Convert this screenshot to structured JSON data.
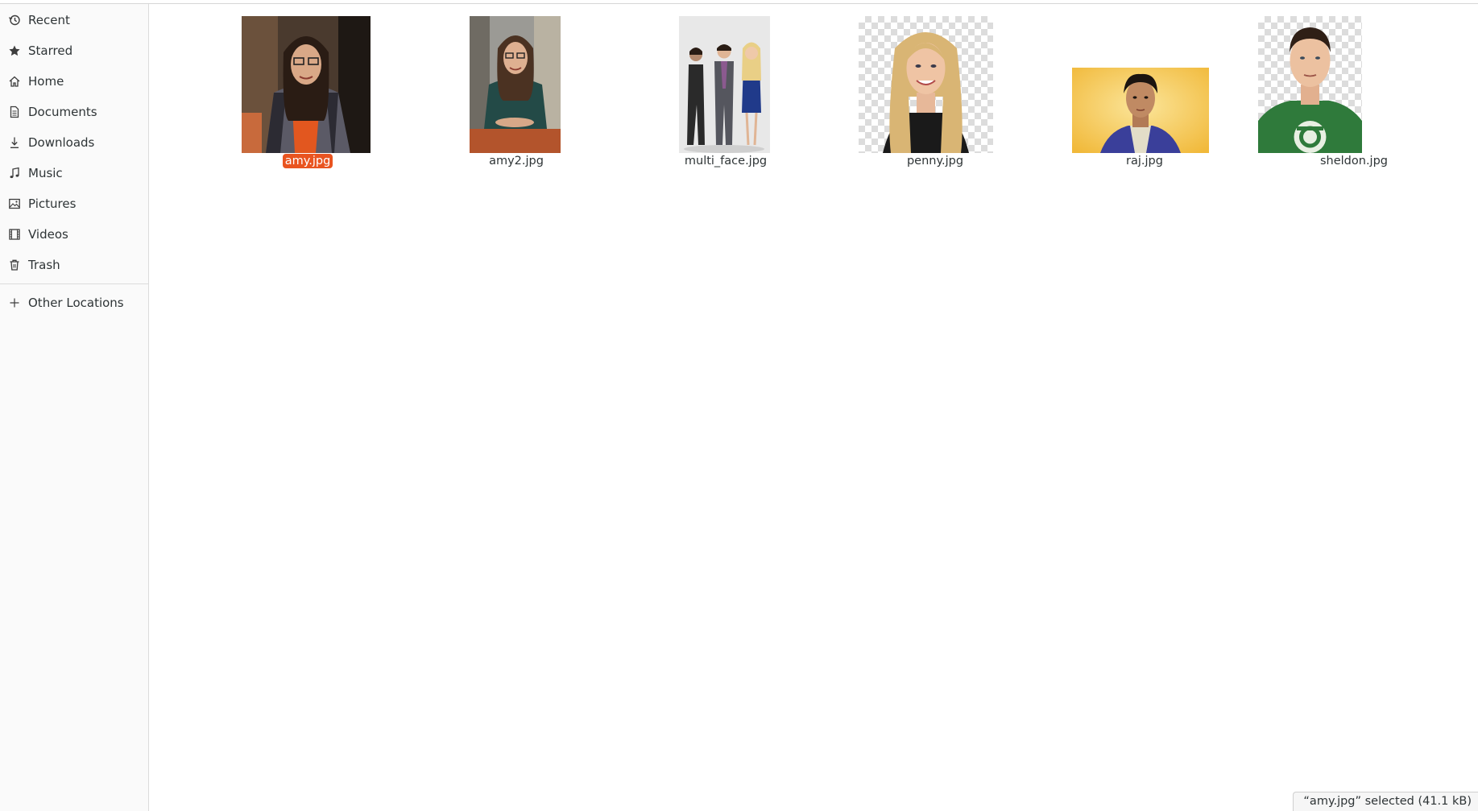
{
  "sidebar": {
    "items": [
      {
        "label": "Recent",
        "icon": "clock-icon"
      },
      {
        "label": "Starred",
        "icon": "star-icon"
      },
      {
        "label": "Home",
        "icon": "home-icon"
      },
      {
        "label": "Documents",
        "icon": "document-icon"
      },
      {
        "label": "Downloads",
        "icon": "download-icon"
      },
      {
        "label": "Music",
        "icon": "music-note-icon"
      },
      {
        "label": "Pictures",
        "icon": "picture-icon"
      },
      {
        "label": "Videos",
        "icon": "film-icon"
      },
      {
        "label": "Trash",
        "icon": "trash-icon"
      }
    ],
    "other_locations": {
      "label": "Other Locations",
      "icon": "plus-icon"
    }
  },
  "files": [
    {
      "name": "amy.jpg",
      "selected": true
    },
    {
      "name": "amy2.jpg",
      "selected": false
    },
    {
      "name": "multi_face.jpg",
      "selected": false
    },
    {
      "name": "penny.jpg",
      "selected": false
    },
    {
      "name": "raj.jpg",
      "selected": false
    },
    {
      "name": "sheldon.jpg",
      "selected": false
    }
  ],
  "status": {
    "text": "“amy.jpg” selected  (41.1 kB)"
  },
  "colors": {
    "selection": "#e95420",
    "sidebar_bg": "#fafafa"
  }
}
